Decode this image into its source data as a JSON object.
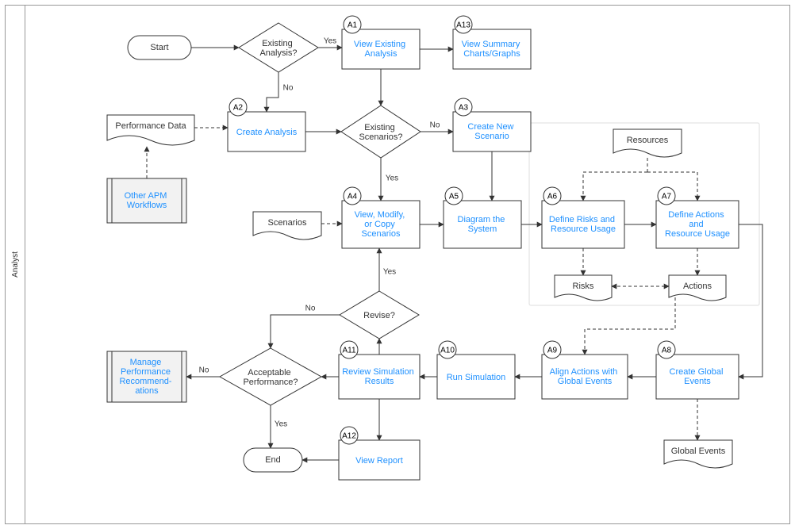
{
  "lane": "Analyst",
  "start": "Start",
  "end": "End",
  "decisions": {
    "existing_analysis": "Existing\nAnalysis?",
    "existing_scenarios": "Existing\nScenarios?",
    "revise": "Revise?",
    "acceptable": "Acceptable\nPerformance?"
  },
  "edges": {
    "yes1": "Yes",
    "no1": "No",
    "yes2": "Yes",
    "no2": "No",
    "yes3": "Yes",
    "no3": "No",
    "yes4": "Yes",
    "no4": "No"
  },
  "processes": {
    "A1": "View Existing\nAnalysis",
    "A2": "Create Analysis",
    "A3": "Create New\nScenario",
    "A4": "View, Modify,\nor Copy\nScenarios",
    "A5": "Diagram the\nSystem",
    "A6": "Define Risks and\nResource Usage",
    "A7": "Define Actions\nand\nResource Usage",
    "A8": "Create Global\nEvents",
    "A9": "Align Actions with\nGlobal Events",
    "A10": "Run Simulation",
    "A11": "Review Simulation\nResults",
    "A12": "View Report",
    "A13": "View Summary\nCharts/Graphs"
  },
  "ids": {
    "A1": "A1",
    "A2": "A2",
    "A3": "A3",
    "A4": "A4",
    "A5": "A5",
    "A6": "A6",
    "A7": "A7",
    "A8": "A8",
    "A9": "A9",
    "A10": "A10",
    "A11": "A11",
    "A12": "A12",
    "A13": "A13"
  },
  "docs": {
    "performance_data": "Performance Data",
    "scenarios": "Scenarios",
    "resources": "Resources",
    "risks": "Risks",
    "actions": "Actions",
    "global_events": "Global Events"
  },
  "predef": {
    "other_apm": "Other APM\nWorkflows",
    "manage_recs": "Manage\nPerformance\nRecommend-\nations"
  }
}
